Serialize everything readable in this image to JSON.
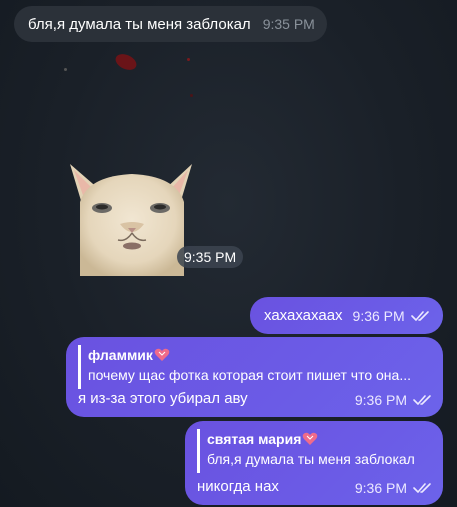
{
  "colors": {
    "background": "#1a2028",
    "incoming_bubble": "#2b3139",
    "outgoing_bubble": "#6b5be6",
    "read_check": "#ece9ff"
  },
  "messages": [
    {
      "direction": "incoming",
      "text": "бля,я думала ты меня заблокал",
      "time": "9:35 PM"
    },
    {
      "direction": "incoming",
      "type": "sticker",
      "sticker_icon": "cat-sticker-icon",
      "time": "9:35 PM"
    },
    {
      "direction": "outgoing",
      "text": "хахахахаах",
      "time": "9:36 PM",
      "status_icon": "double-check-icon"
    },
    {
      "direction": "outgoing",
      "reply": {
        "author": "фламмик",
        "author_icon": "heart-icon",
        "text": "почему щас фотка которая стоит пишет что она..."
      },
      "text": "я из-за этого убирал аву",
      "time": "9:36 PM",
      "status_icon": "double-check-icon"
    },
    {
      "direction": "outgoing",
      "reply": {
        "author": "святая мария",
        "author_icon": "heart-icon",
        "text": "бля,я думала ты меня заблокал"
      },
      "text": "никогда нах",
      "time": "9:36 PM",
      "status_icon": "double-check-icon"
    }
  ]
}
